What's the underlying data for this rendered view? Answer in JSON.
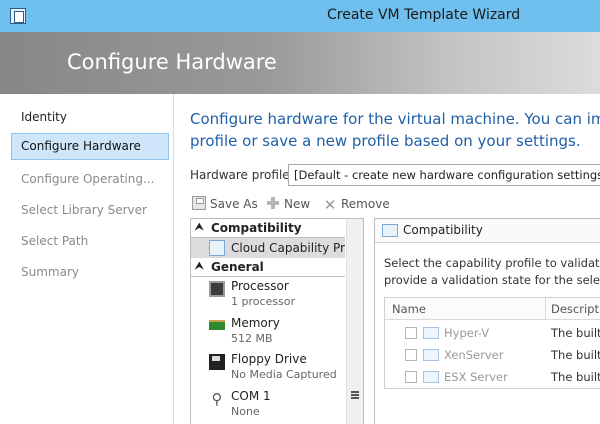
{
  "window": {
    "title": "Create VM Template Wizard"
  },
  "banner": {
    "title": "Configure Hardware"
  },
  "nav": {
    "items": [
      {
        "label": "Identity",
        "state": "normal"
      },
      {
        "label": "Configure Hardware",
        "state": "active"
      },
      {
        "label": "Configure Operating...",
        "state": "disabled"
      },
      {
        "label": "Select Library Server",
        "state": "disabled"
      },
      {
        "label": "Select Path",
        "state": "disabled"
      },
      {
        "label": "Summary",
        "state": "disabled"
      }
    ]
  },
  "main": {
    "intro_line1": "Configure hardware for the virtual machine. You can impor",
    "intro_line2": "profile or save a new profile based on your settings.",
    "hardware_profile_label": "Hardware profile:",
    "hardware_profile_value": "[Default - create new hardware configuration settings]",
    "toolbar": {
      "save_as": "Save As",
      "new": "New",
      "remove": "Remove"
    }
  },
  "hardware_list": {
    "sections": [
      {
        "title": "Compatibility",
        "items": [
          {
            "name": "Cloud Capability Pr...",
            "detail": "",
            "icon": "cloud-capability-icon"
          }
        ]
      },
      {
        "title": "General",
        "items": [
          {
            "name": "Processor",
            "detail": "1 processor",
            "icon": "processor-icon"
          },
          {
            "name": "Memory",
            "detail": "512 MB",
            "icon": "memory-icon"
          },
          {
            "name": "Floppy Drive",
            "detail": "No Media Captured",
            "icon": "floppy-drive-icon"
          },
          {
            "name": "COM 1",
            "detail": "None",
            "icon": "com-port-icon"
          }
        ]
      }
    ]
  },
  "detail": {
    "header": "Compatibility",
    "desc_line1": "Select the capability profile to validate ag",
    "desc_line2": "provide a validation state for the selected",
    "columns": {
      "name": "Name",
      "description": "Descriptio"
    },
    "rows": [
      {
        "name": "Hyper-V",
        "description": "The built-",
        "checked": false
      },
      {
        "name": "XenServer",
        "description": "The built-",
        "checked": false
      },
      {
        "name": "ESX Server",
        "description": "The built-",
        "checked": false
      }
    ]
  }
}
